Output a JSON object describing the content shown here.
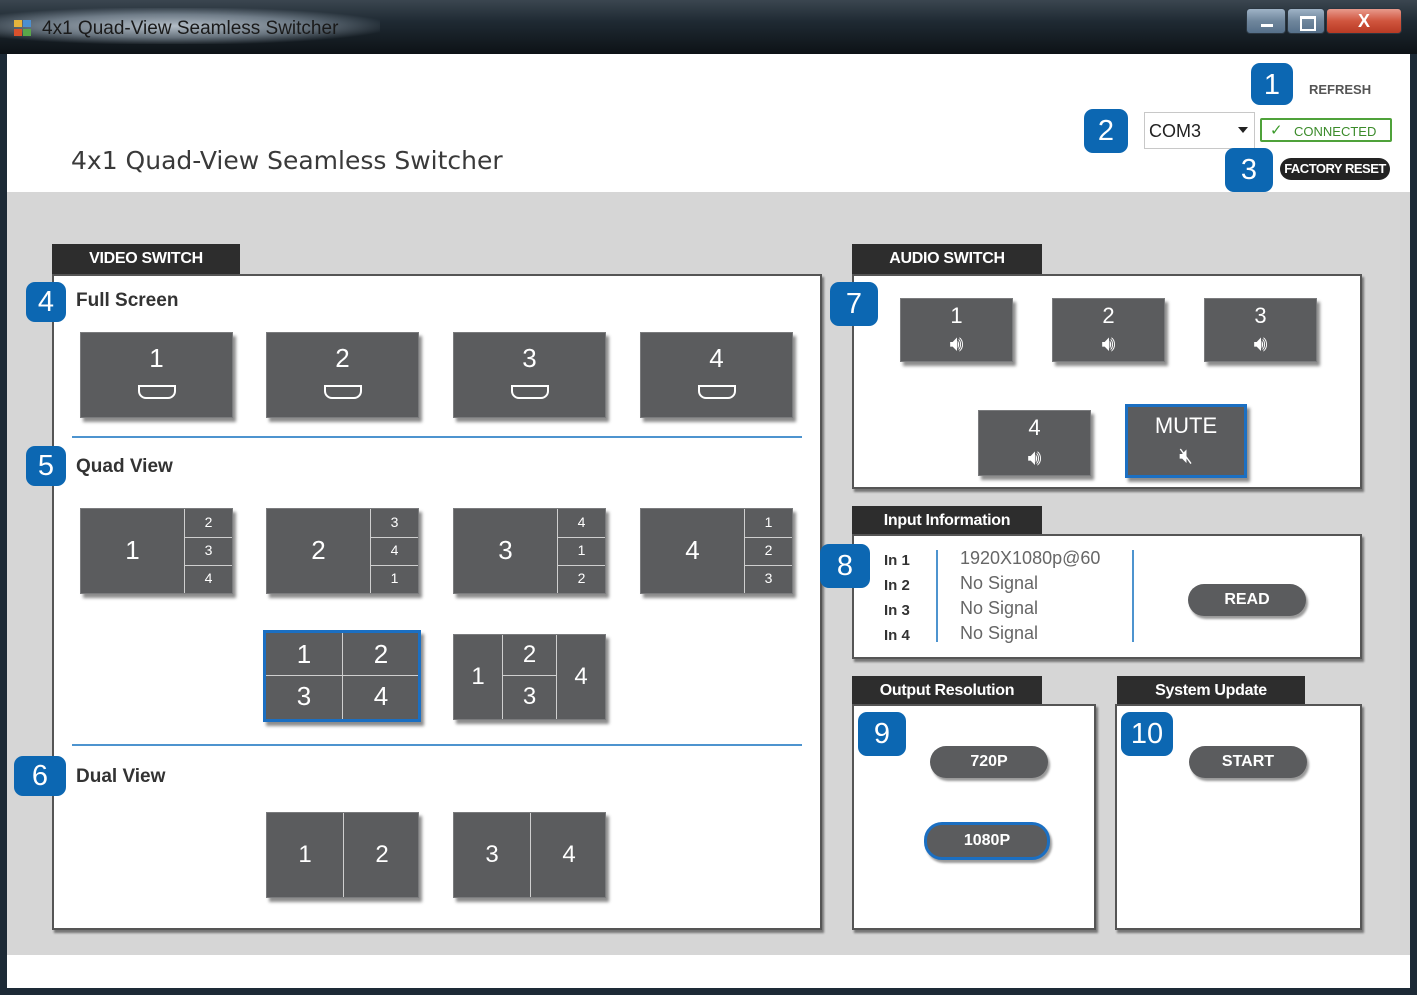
{
  "window": {
    "title": "4x1 Quad-View Seamless Switcher",
    "close_glyph": "X"
  },
  "header": {
    "app_title": "4x1 Quad-View Seamless Switcher",
    "refresh_label": "REFRESH",
    "com_port": "COM3",
    "connection_status": "CONNECTED",
    "factory_reset_label": "FACTORY RESET"
  },
  "badges": [
    "1",
    "2",
    "3",
    "4",
    "5",
    "6",
    "7",
    "8",
    "9",
    "10"
  ],
  "video_switch": {
    "tab": "VIDEO SWITCH",
    "full_screen": {
      "label": "Full Screen",
      "inputs": [
        "1",
        "2",
        "3",
        "4"
      ]
    },
    "quad_view": {
      "label": "Quad View",
      "layouts": [
        {
          "main": "1",
          "side": [
            "2",
            "3",
            "4"
          ]
        },
        {
          "main": "2",
          "side": [
            "3",
            "4",
            "1"
          ]
        },
        {
          "main": "3",
          "side": [
            "4",
            "1",
            "2"
          ]
        },
        {
          "main": "4",
          "side": [
            "1",
            "2",
            "3"
          ]
        }
      ],
      "grid": [
        "1",
        "2",
        "3",
        "4"
      ],
      "pip": {
        "left": "1",
        "mid_top": "2",
        "mid_bottom": "3",
        "right": "4"
      }
    },
    "dual_view": {
      "label": "Dual View",
      "pairs": [
        [
          "1",
          "2"
        ],
        [
          "3",
          "4"
        ]
      ]
    }
  },
  "audio_switch": {
    "tab": "AUDIO SWITCH",
    "inputs": [
      "1",
      "2",
      "3",
      "4"
    ],
    "mute_label": "MUTE",
    "speaker_glyph": "🔊︎",
    "mute_glyph": "🔇︎"
  },
  "input_information": {
    "tab": "Input Information",
    "rows": [
      {
        "label": "In 1",
        "value": "1920X1080p@60"
      },
      {
        "label": "In 2",
        "value": "No Signal"
      },
      {
        "label": "In 3",
        "value": "No Signal"
      },
      {
        "label": "In 4",
        "value": "No Signal"
      }
    ],
    "read_label": "READ"
  },
  "output_resolution": {
    "tab": "Output Resolution",
    "options": [
      "720P",
      "1080P"
    ],
    "selected": "1080P"
  },
  "system_update": {
    "tab": "System Update",
    "start_label": "START"
  },
  "colors": {
    "accent_blue": "#0c67b2",
    "tile_gray": "#5b5c5e",
    "connected_green": "#4fa23a"
  }
}
